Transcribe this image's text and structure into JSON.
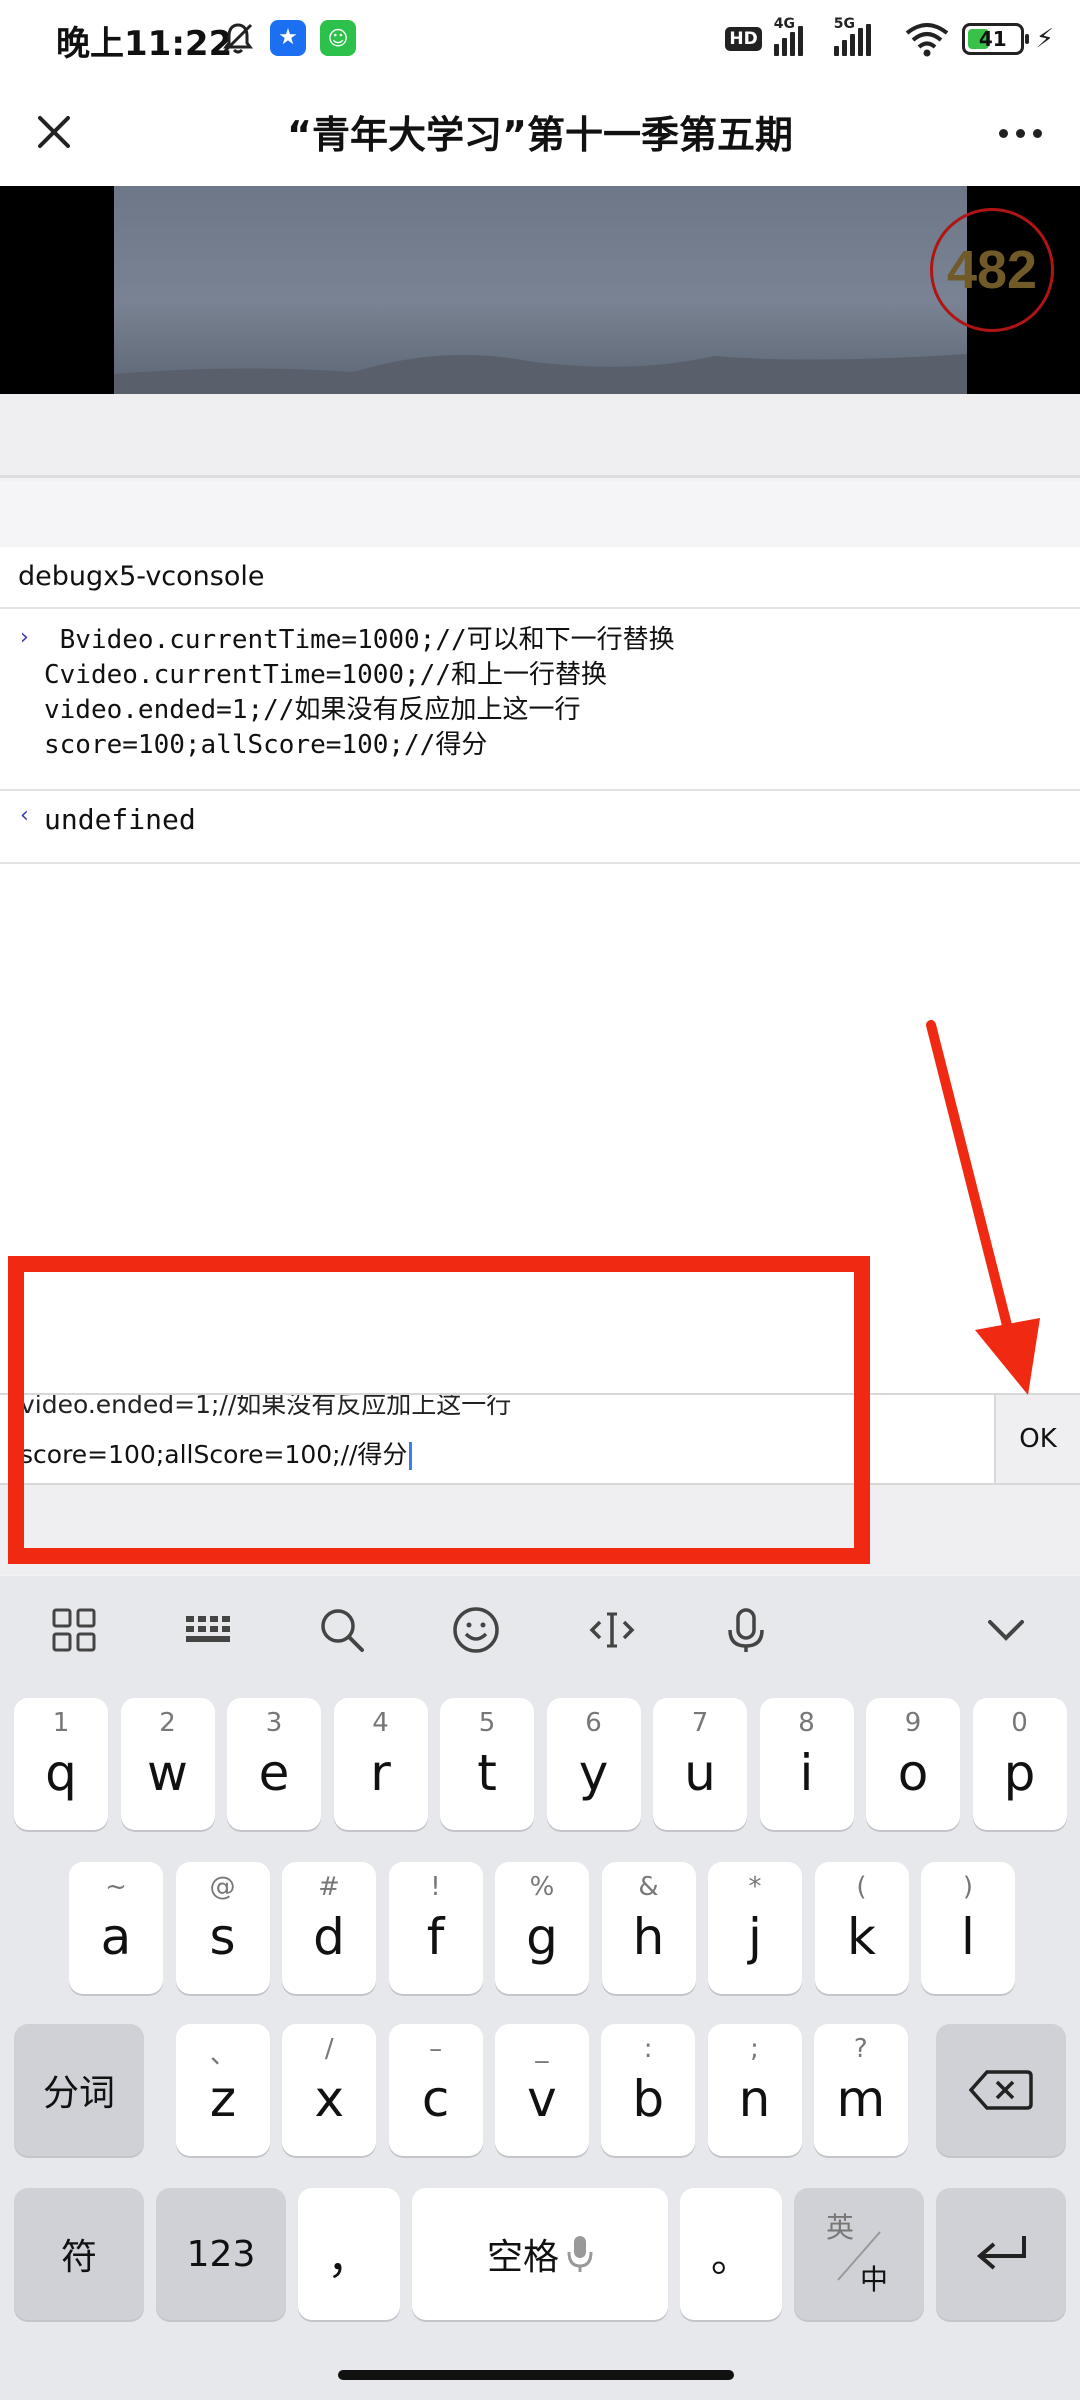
{
  "status_bar": {
    "time": "晚上11:22",
    "hd": "HD",
    "net1": "4G",
    "net2": "5G",
    "battery": "41",
    "battery_level": 0.41
  },
  "nav": {
    "title": "“青年大学习”第十一季第五期"
  },
  "video": {
    "counter": "482"
  },
  "console": {
    "title": "debugx5-vconsole",
    "prompt_in": "›",
    "prompt_out": "‹",
    "command_lines": [
      " Bvideo.currentTime=1000;//可以和下一行替换",
      "Cvideo.currentTime=1000;//和上一行替换",
      "video.ended=1;//如果没有反应加上这一行",
      "score=100;allScore=100;//得分"
    ],
    "result": "undefined"
  },
  "input": {
    "line1": "video.ended=1;//如果没有反应加上这一行",
    "line2": "score=100;allScore=100;//得分",
    "ok_label": "OK"
  },
  "keyboard": {
    "row1": [
      {
        "hint": "1",
        "key": "q"
      },
      {
        "hint": "2",
        "key": "w"
      },
      {
        "hint": "3",
        "key": "e"
      },
      {
        "hint": "4",
        "key": "r"
      },
      {
        "hint": "5",
        "key": "t"
      },
      {
        "hint": "6",
        "key": "y"
      },
      {
        "hint": "7",
        "key": "u"
      },
      {
        "hint": "8",
        "key": "i"
      },
      {
        "hint": "9",
        "key": "o"
      },
      {
        "hint": "0",
        "key": "p"
      }
    ],
    "row2": [
      {
        "hint": "~",
        "key": "a"
      },
      {
        "hint": "@",
        "key": "s"
      },
      {
        "hint": "#",
        "key": "d"
      },
      {
        "hint": "!",
        "key": "f"
      },
      {
        "hint": "%",
        "key": "g"
      },
      {
        "hint": "&",
        "key": "h"
      },
      {
        "hint": "*",
        "key": "j"
      },
      {
        "hint": "(",
        "key": "k"
      },
      {
        "hint": ")",
        "key": "l"
      }
    ],
    "row3": [
      {
        "hint": "、",
        "key": "z"
      },
      {
        "hint": "/",
        "key": "x"
      },
      {
        "hint": "–",
        "key": "c"
      },
      {
        "hint": "_",
        "key": "v"
      },
      {
        "hint": ":",
        "key": "b"
      },
      {
        "hint": ";",
        "key": "n"
      },
      {
        "hint": "?",
        "key": "m"
      }
    ],
    "split_label": "分词",
    "symbol_label": "符",
    "num_label": "123",
    "comma_label": "，",
    "space_label": "空格",
    "period_label": "。",
    "lang_top": "英",
    "lang_bottom": "中"
  },
  "colors": {
    "annotation_red": "#f02a12",
    "caret_blue": "#3c7cf0",
    "battery_green": "#39c24a"
  }
}
